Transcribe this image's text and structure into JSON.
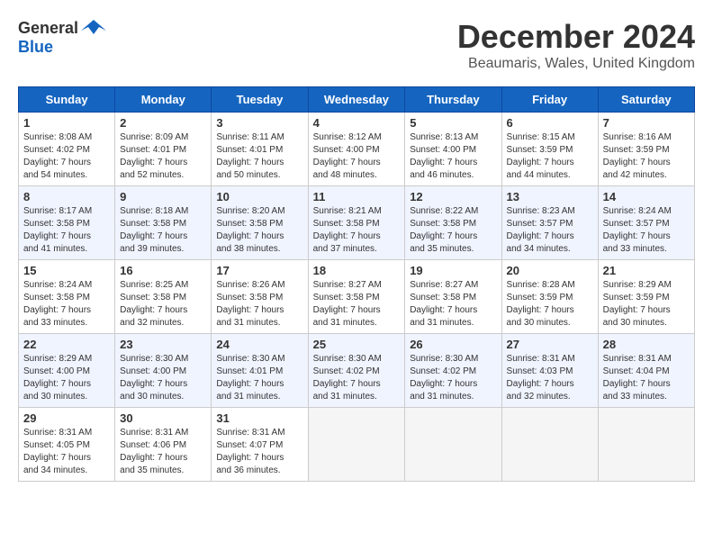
{
  "logo": {
    "general": "General",
    "blue": "Blue"
  },
  "title": "December 2024",
  "location": "Beaumaris, Wales, United Kingdom",
  "days_of_week": [
    "Sunday",
    "Monday",
    "Tuesday",
    "Wednesday",
    "Thursday",
    "Friday",
    "Saturday"
  ],
  "weeks": [
    [
      {
        "day": "1",
        "sunrise": "Sunrise: 8:08 AM",
        "sunset": "Sunset: 4:02 PM",
        "daylight": "Daylight: 7 hours and 54 minutes."
      },
      {
        "day": "2",
        "sunrise": "Sunrise: 8:09 AM",
        "sunset": "Sunset: 4:01 PM",
        "daylight": "Daylight: 7 hours and 52 minutes."
      },
      {
        "day": "3",
        "sunrise": "Sunrise: 8:11 AM",
        "sunset": "Sunset: 4:01 PM",
        "daylight": "Daylight: 7 hours and 50 minutes."
      },
      {
        "day": "4",
        "sunrise": "Sunrise: 8:12 AM",
        "sunset": "Sunset: 4:00 PM",
        "daylight": "Daylight: 7 hours and 48 minutes."
      },
      {
        "day": "5",
        "sunrise": "Sunrise: 8:13 AM",
        "sunset": "Sunset: 4:00 PM",
        "daylight": "Daylight: 7 hours and 46 minutes."
      },
      {
        "day": "6",
        "sunrise": "Sunrise: 8:15 AM",
        "sunset": "Sunset: 3:59 PM",
        "daylight": "Daylight: 7 hours and 44 minutes."
      },
      {
        "day": "7",
        "sunrise": "Sunrise: 8:16 AM",
        "sunset": "Sunset: 3:59 PM",
        "daylight": "Daylight: 7 hours and 42 minutes."
      }
    ],
    [
      {
        "day": "8",
        "sunrise": "Sunrise: 8:17 AM",
        "sunset": "Sunset: 3:58 PM",
        "daylight": "Daylight: 7 hours and 41 minutes."
      },
      {
        "day": "9",
        "sunrise": "Sunrise: 8:18 AM",
        "sunset": "Sunset: 3:58 PM",
        "daylight": "Daylight: 7 hours and 39 minutes."
      },
      {
        "day": "10",
        "sunrise": "Sunrise: 8:20 AM",
        "sunset": "Sunset: 3:58 PM",
        "daylight": "Daylight: 7 hours and 38 minutes."
      },
      {
        "day": "11",
        "sunrise": "Sunrise: 8:21 AM",
        "sunset": "Sunset: 3:58 PM",
        "daylight": "Daylight: 7 hours and 37 minutes."
      },
      {
        "day": "12",
        "sunrise": "Sunrise: 8:22 AM",
        "sunset": "Sunset: 3:58 PM",
        "daylight": "Daylight: 7 hours and 35 minutes."
      },
      {
        "day": "13",
        "sunrise": "Sunrise: 8:23 AM",
        "sunset": "Sunset: 3:57 PM",
        "daylight": "Daylight: 7 hours and 34 minutes."
      },
      {
        "day": "14",
        "sunrise": "Sunrise: 8:24 AM",
        "sunset": "Sunset: 3:57 PM",
        "daylight": "Daylight: 7 hours and 33 minutes."
      }
    ],
    [
      {
        "day": "15",
        "sunrise": "Sunrise: 8:24 AM",
        "sunset": "Sunset: 3:58 PM",
        "daylight": "Daylight: 7 hours and 33 minutes."
      },
      {
        "day": "16",
        "sunrise": "Sunrise: 8:25 AM",
        "sunset": "Sunset: 3:58 PM",
        "daylight": "Daylight: 7 hours and 32 minutes."
      },
      {
        "day": "17",
        "sunrise": "Sunrise: 8:26 AM",
        "sunset": "Sunset: 3:58 PM",
        "daylight": "Daylight: 7 hours and 31 minutes."
      },
      {
        "day": "18",
        "sunrise": "Sunrise: 8:27 AM",
        "sunset": "Sunset: 3:58 PM",
        "daylight": "Daylight: 7 hours and 31 minutes."
      },
      {
        "day": "19",
        "sunrise": "Sunrise: 8:27 AM",
        "sunset": "Sunset: 3:58 PM",
        "daylight": "Daylight: 7 hours and 31 minutes."
      },
      {
        "day": "20",
        "sunrise": "Sunrise: 8:28 AM",
        "sunset": "Sunset: 3:59 PM",
        "daylight": "Daylight: 7 hours and 30 minutes."
      },
      {
        "day": "21",
        "sunrise": "Sunrise: 8:29 AM",
        "sunset": "Sunset: 3:59 PM",
        "daylight": "Daylight: 7 hours and 30 minutes."
      }
    ],
    [
      {
        "day": "22",
        "sunrise": "Sunrise: 8:29 AM",
        "sunset": "Sunset: 4:00 PM",
        "daylight": "Daylight: 7 hours and 30 minutes."
      },
      {
        "day": "23",
        "sunrise": "Sunrise: 8:30 AM",
        "sunset": "Sunset: 4:00 PM",
        "daylight": "Daylight: 7 hours and 30 minutes."
      },
      {
        "day": "24",
        "sunrise": "Sunrise: 8:30 AM",
        "sunset": "Sunset: 4:01 PM",
        "daylight": "Daylight: 7 hours and 31 minutes."
      },
      {
        "day": "25",
        "sunrise": "Sunrise: 8:30 AM",
        "sunset": "Sunset: 4:02 PM",
        "daylight": "Daylight: 7 hours and 31 minutes."
      },
      {
        "day": "26",
        "sunrise": "Sunrise: 8:30 AM",
        "sunset": "Sunset: 4:02 PM",
        "daylight": "Daylight: 7 hours and 31 minutes."
      },
      {
        "day": "27",
        "sunrise": "Sunrise: 8:31 AM",
        "sunset": "Sunset: 4:03 PM",
        "daylight": "Daylight: 7 hours and 32 minutes."
      },
      {
        "day": "28",
        "sunrise": "Sunrise: 8:31 AM",
        "sunset": "Sunset: 4:04 PM",
        "daylight": "Daylight: 7 hours and 33 minutes."
      }
    ],
    [
      {
        "day": "29",
        "sunrise": "Sunrise: 8:31 AM",
        "sunset": "Sunset: 4:05 PM",
        "daylight": "Daylight: 7 hours and 34 minutes."
      },
      {
        "day": "30",
        "sunrise": "Sunrise: 8:31 AM",
        "sunset": "Sunset: 4:06 PM",
        "daylight": "Daylight: 7 hours and 35 minutes."
      },
      {
        "day": "31",
        "sunrise": "Sunrise: 8:31 AM",
        "sunset": "Sunset: 4:07 PM",
        "daylight": "Daylight: 7 hours and 36 minutes."
      },
      null,
      null,
      null,
      null
    ]
  ]
}
